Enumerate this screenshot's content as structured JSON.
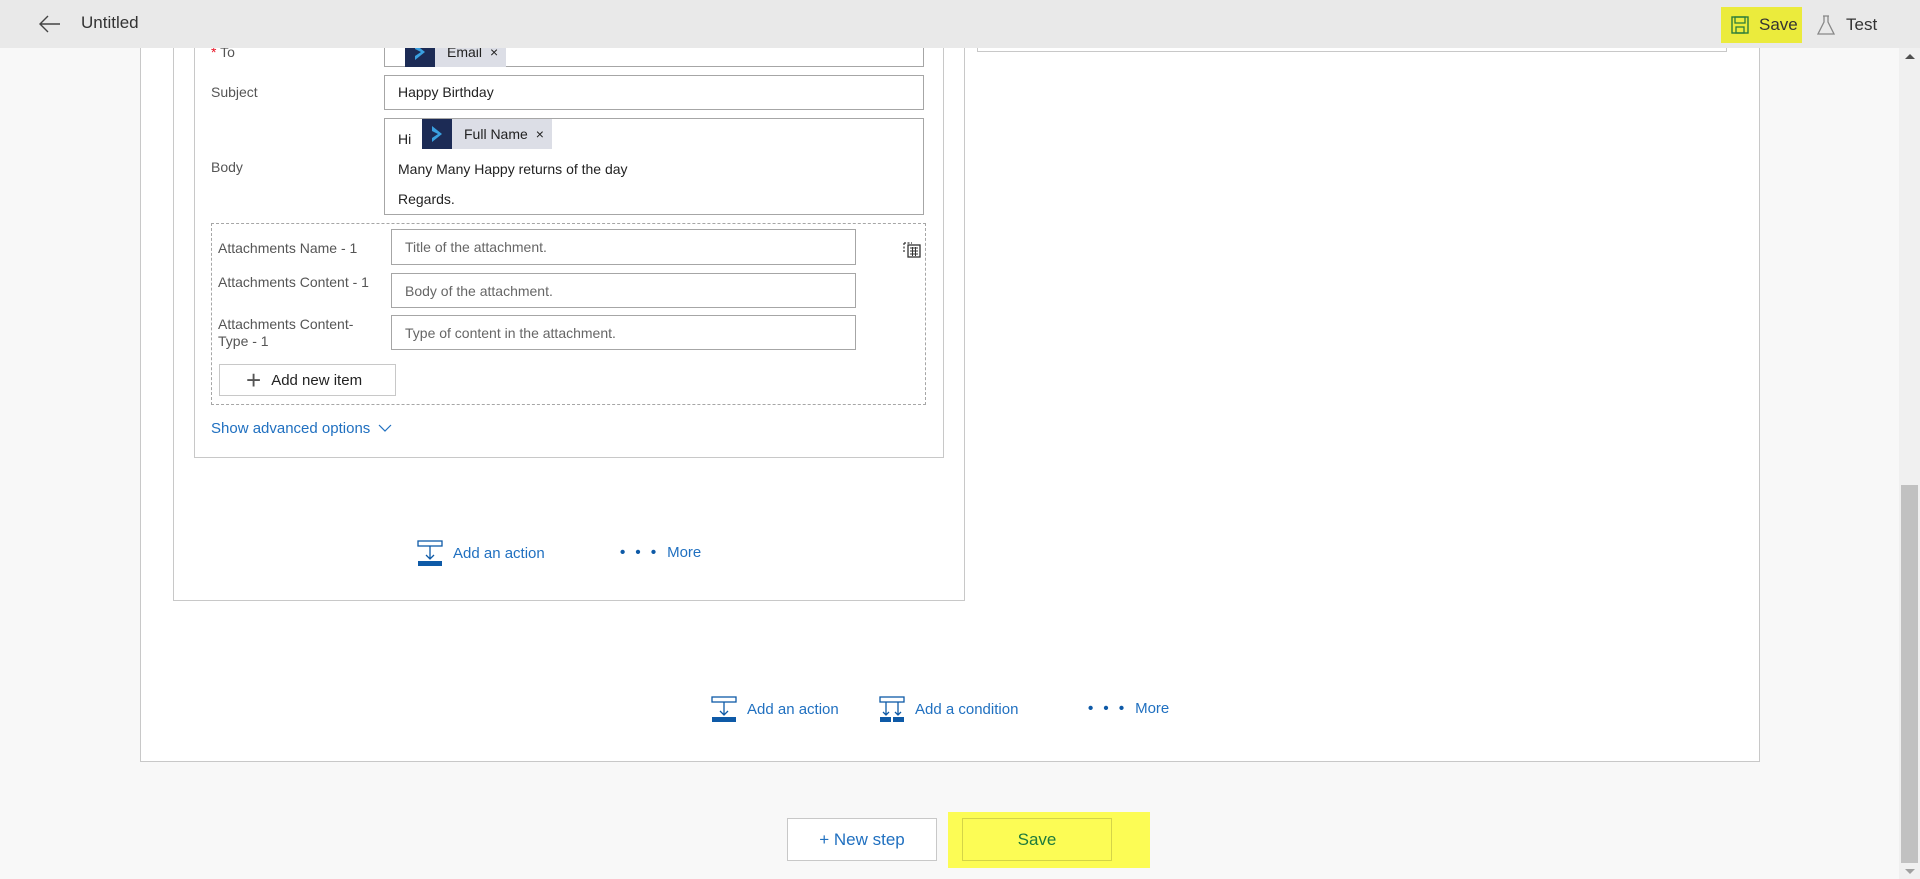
{
  "header": {
    "title": "Untitled",
    "save_label": "Save",
    "test_label": "Test"
  },
  "email_action": {
    "to_label": "To",
    "to_required_marker": "*",
    "to_token": "Email",
    "subject_label": "Subject",
    "subject_value": "Happy Birthday",
    "body_label": "Body",
    "body_line1_prefix": "Hi",
    "body_token": "Full Name",
    "body_line2": "Many Many Happy returns of the day",
    "body_line3": "Regards.",
    "token_remove": "×",
    "attachments": {
      "name_label": "Attachments Name - 1",
      "name_placeholder": "Title of the attachment.",
      "content_label": "Attachments Content - 1",
      "content_placeholder": "Body of the attachment.",
      "type_label": "Attachments Content-Type - 1",
      "type_placeholder": "Type of content in the attachment.",
      "add_item_label": "Add new item"
    },
    "advanced_options_label": "Show advanced options"
  },
  "branch_footer": {
    "add_action_label": "Add an action",
    "more_label": "More",
    "more_dots": "• • •"
  },
  "outer_footer": {
    "add_action_label": "Add an action",
    "add_condition_label": "Add a condition",
    "more_label": "More",
    "more_dots": "• • •"
  },
  "bottom": {
    "new_step_label": "+ New step",
    "save_label": "Save"
  },
  "colors": {
    "accent_blue": "#2070c0",
    "highlight_yellow": "#fcfc55",
    "token_icon_bg": "#1c2b55",
    "token_bg": "#dcdee6"
  }
}
